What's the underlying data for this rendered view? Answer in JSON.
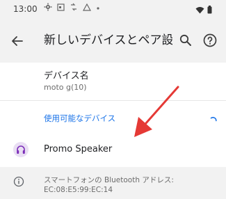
{
  "status_bar": {
    "time": "13:00",
    "icons": [
      "settings-icon",
      "calendar-icon",
      "signal-arrows-icon",
      "alert-icon",
      "dot-icon"
    ],
    "right_icons": [
      "wifi-icon",
      "battery-icon"
    ]
  },
  "app_bar": {
    "title": "新しいデバイスとペア設…",
    "icons": [
      "back-arrow-icon",
      "search-icon",
      "help-icon"
    ]
  },
  "device_name": {
    "label": "デバイス名",
    "value": "moto g(10)"
  },
  "available_devices": {
    "header": "使用可能なデバイス",
    "accent_color": "#1a73e8",
    "items": [
      {
        "name": "Promo Speaker",
        "icon": "headphones-icon"
      }
    ]
  },
  "info": {
    "text_line1": "スマートフォンの Bluetooth アドレス:",
    "text_line2": "EC:08:E5:99:EC:14",
    "icon": "info-icon"
  },
  "annotation": {
    "icon": "red-arrow-annotation",
    "color": "#e53935"
  }
}
